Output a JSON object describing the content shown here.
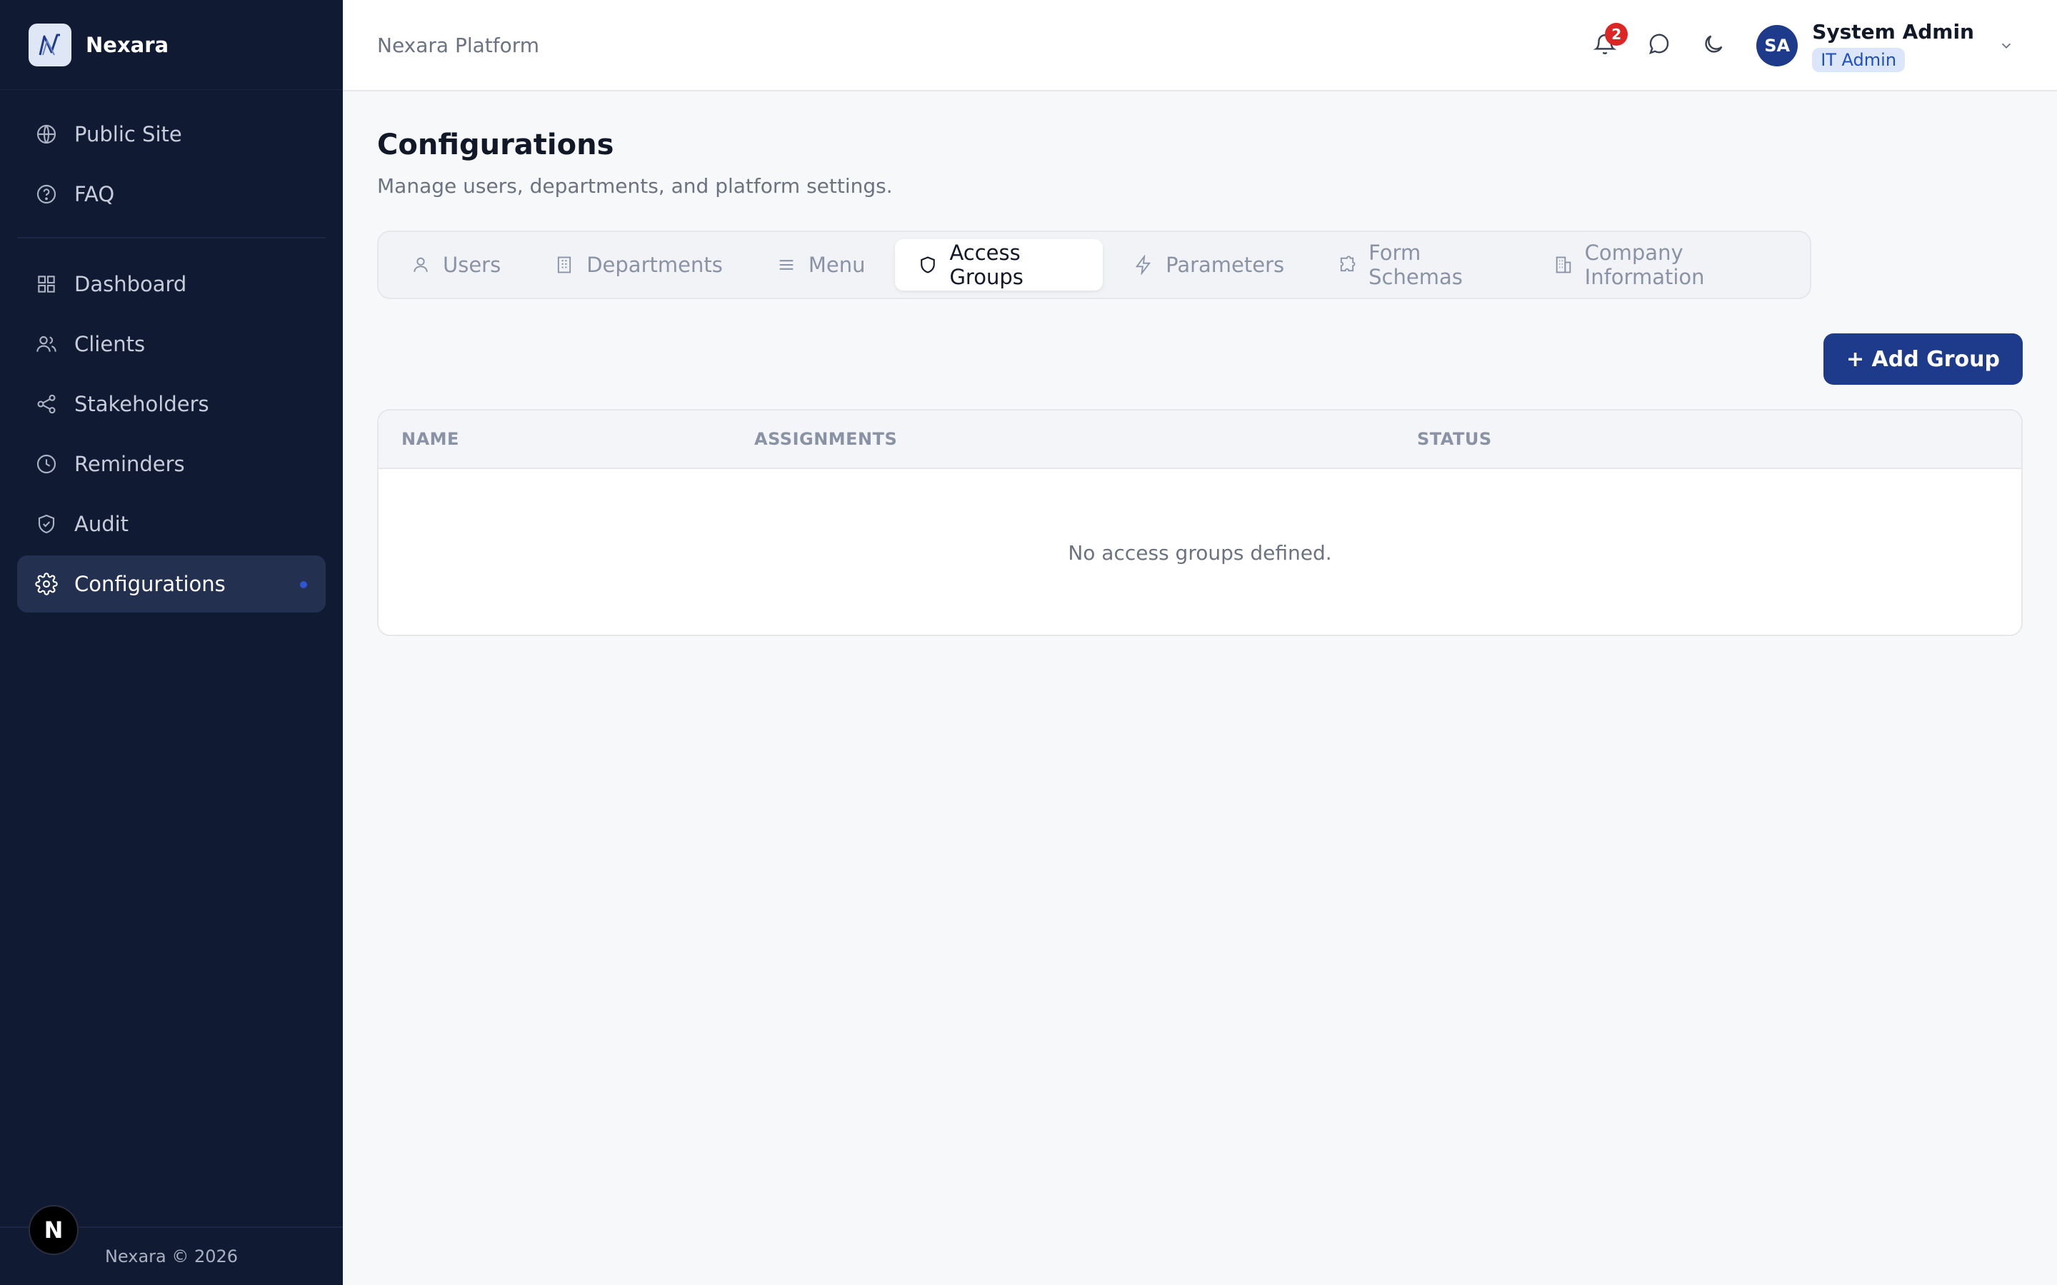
{
  "brand": {
    "name": "Nexara"
  },
  "sidebar": {
    "groups": [
      {
        "items": [
          {
            "label": "Public Site",
            "icon": "globe-icon"
          },
          {
            "label": "FAQ",
            "icon": "help-circle-icon"
          }
        ]
      },
      {
        "items": [
          {
            "label": "Dashboard",
            "icon": "grid-icon"
          },
          {
            "label": "Clients",
            "icon": "users-icon"
          },
          {
            "label": "Stakeholders",
            "icon": "share-icon"
          },
          {
            "label": "Reminders",
            "icon": "clock-icon"
          },
          {
            "label": "Audit",
            "icon": "shield-check-icon"
          },
          {
            "label": "Configurations",
            "icon": "gear-icon",
            "active": true
          }
        ]
      }
    ],
    "footer": "Nexara © 2026",
    "badge": "N"
  },
  "topbar": {
    "title": "Nexara Platform",
    "notifications_count": "2",
    "user": {
      "initials": "SA",
      "name": "System Admin",
      "role": "IT Admin"
    }
  },
  "page": {
    "title": "Configurations",
    "subtitle": "Manage users, departments, and platform settings."
  },
  "tabs": [
    {
      "label": "Users",
      "icon": "user-icon"
    },
    {
      "label": "Departments",
      "icon": "building-icon"
    },
    {
      "label": "Menu",
      "icon": "menu-icon"
    },
    {
      "label": "Access Groups",
      "icon": "shield-icon",
      "active": true
    },
    {
      "label": "Parameters",
      "icon": "zap-icon"
    },
    {
      "label": "Form Schemas",
      "icon": "puzzle-icon"
    },
    {
      "label": "Company Information",
      "icon": "office-icon"
    }
  ],
  "toolbar": {
    "add_label": "+ Add Group"
  },
  "table": {
    "columns": [
      "NAME",
      "ASSIGNMENTS",
      "STATUS"
    ],
    "empty_message": "No access groups defined."
  },
  "colors": {
    "sidebar_bg": "#111a33",
    "primary": "#1e3a8a",
    "badge_red": "#dc2626",
    "role_bg": "#dbe6fb"
  }
}
